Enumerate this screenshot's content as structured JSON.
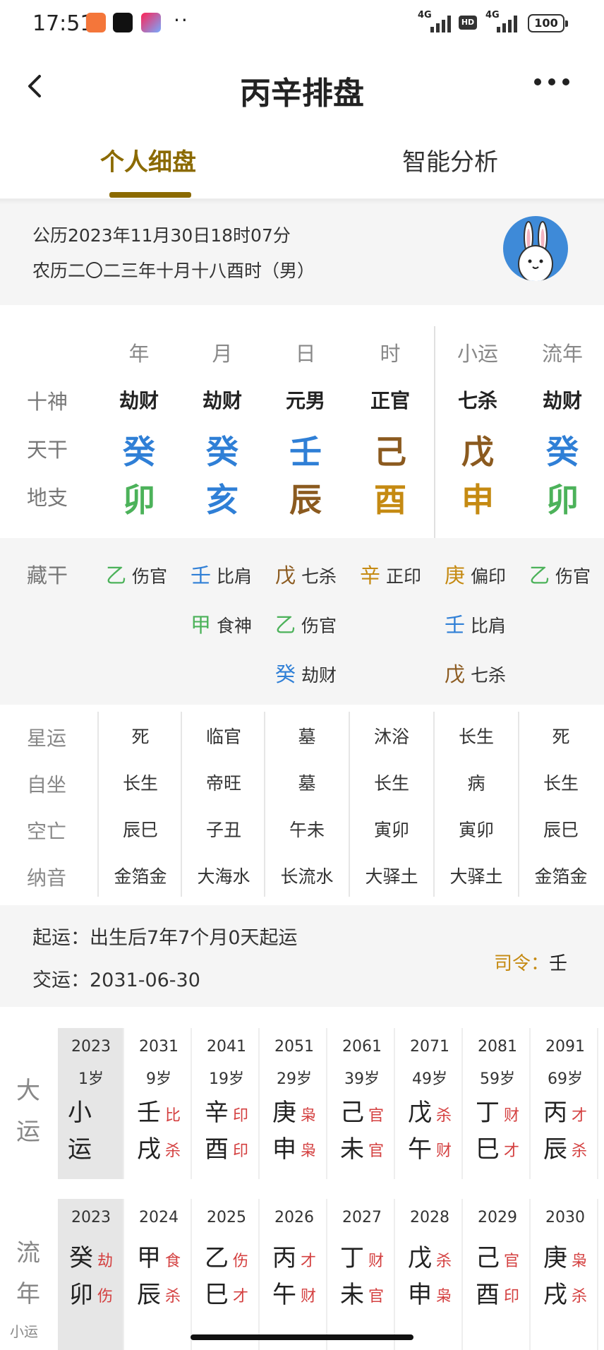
{
  "status_bar": {
    "time": "17:51",
    "net1": "4G",
    "net2": "4G",
    "hd": "HD",
    "battery": "100"
  },
  "nav": {
    "title": "丙辛排盘",
    "back_icon": "chevron-left-icon",
    "more_icon": "more-dots-icon"
  },
  "tabs": [
    {
      "label": "个人细盘",
      "active": true
    },
    {
      "label": "智能分析",
      "active": false
    }
  ],
  "info": {
    "solar": "公历2023年11月30日18时07分",
    "lunar": "农历二〇二三年十月十八酉时（男）",
    "avatar_icon": "rabbit-avatar-icon"
  },
  "pillars": {
    "headers": [
      "年",
      "月",
      "日",
      "时",
      "小运",
      "流年"
    ],
    "row_labels": [
      "十神",
      "天干",
      "地支"
    ],
    "shishen": [
      "劫财",
      "劫财",
      "元男",
      "正官",
      "七杀",
      "劫财"
    ],
    "tiangan": [
      "癸",
      "癸",
      "壬",
      "己",
      "戊",
      "癸"
    ],
    "dizhi": [
      "卯",
      "亥",
      "辰",
      "酉",
      "申",
      "卯"
    ],
    "colors": {
      "blue": "#2f7fd6",
      "green": "#4cb25a",
      "brown": "#8b5a1f",
      "gold": "#c58a12"
    }
  },
  "hidden_stems": {
    "label": "藏干",
    "columns": [
      [
        {
          "stem": "乙",
          "god": "伤官"
        }
      ],
      [
        {
          "stem": "壬",
          "god": "比肩"
        },
        {
          "stem": "甲",
          "god": "食神"
        }
      ],
      [
        {
          "stem": "戊",
          "god": "七杀"
        },
        {
          "stem": "乙",
          "god": "伤官"
        },
        {
          "stem": "癸",
          "god": "劫财"
        }
      ],
      [
        {
          "stem": "辛",
          "god": "正印"
        }
      ],
      [
        {
          "stem": "庚",
          "god": "偏印"
        },
        {
          "stem": "壬",
          "god": "比肩"
        },
        {
          "stem": "戊",
          "god": "七杀"
        }
      ],
      [
        {
          "stem": "乙",
          "god": "伤官"
        }
      ]
    ]
  },
  "details": {
    "labels": [
      "星运",
      "自坐",
      "空亡",
      "纳音"
    ],
    "rows": [
      [
        "死",
        "临官",
        "墓",
        "沐浴",
        "长生",
        "死"
      ],
      [
        "长生",
        "帝旺",
        "墓",
        "长生",
        "病",
        "长生"
      ],
      [
        "辰巳",
        "子丑",
        "午未",
        "寅卯",
        "寅卯",
        "辰巳"
      ],
      [
        "金箔金",
        "大海水",
        "长流水",
        "大驿土",
        "大驿土",
        "金箔金"
      ]
    ]
  },
  "qiyun": {
    "start": "起运：出生后7年7个月0天起运",
    "jiao": "交运：2031-06-30",
    "siling_label": "司令：",
    "siling_value": "壬"
  },
  "dayun": {
    "side_label": [
      "大",
      "运"
    ],
    "first": {
      "year": "2023",
      "age": "1岁",
      "text": [
        "小",
        "运"
      ]
    },
    "items": [
      {
        "year": "2031",
        "age": "9岁",
        "gan": "壬",
        "gan_s": "比",
        "zhi": "戌",
        "zhi_s": "杀"
      },
      {
        "year": "2041",
        "age": "19岁",
        "gan": "辛",
        "gan_s": "印",
        "zhi": "酉",
        "zhi_s": "印"
      },
      {
        "year": "2051",
        "age": "29岁",
        "gan": "庚",
        "gan_s": "枭",
        "zhi": "申",
        "zhi_s": "枭"
      },
      {
        "year": "2061",
        "age": "39岁",
        "gan": "己",
        "gan_s": "官",
        "zhi": "未",
        "zhi_s": "官"
      },
      {
        "year": "2071",
        "age": "49岁",
        "gan": "戊",
        "gan_s": "杀",
        "zhi": "午",
        "zhi_s": "财"
      },
      {
        "year": "2081",
        "age": "59岁",
        "gan": "丁",
        "gan_s": "财",
        "zhi": "巳",
        "zhi_s": "才"
      },
      {
        "year": "2091",
        "age": "69岁",
        "gan": "丙",
        "gan_s": "才",
        "zhi": "辰",
        "zhi_s": "杀"
      }
    ]
  },
  "liunian": {
    "side_label": [
      "流",
      "年"
    ],
    "side_sub": "小运",
    "items": [
      {
        "year": "2023",
        "gan": "癸",
        "gan_s": "劫",
        "zhi": "卯",
        "zhi_s": "伤"
      },
      {
        "year": "2024",
        "gan": "甲",
        "gan_s": "食",
        "zhi": "辰",
        "zhi_s": "杀"
      },
      {
        "year": "2025",
        "gan": "乙",
        "gan_s": "伤",
        "zhi": "巳",
        "zhi_s": "才"
      },
      {
        "year": "2026",
        "gan": "丙",
        "gan_s": "才",
        "zhi": "午",
        "zhi_s": "财"
      },
      {
        "year": "2027",
        "gan": "丁",
        "gan_s": "财",
        "zhi": "未",
        "zhi_s": "官"
      },
      {
        "year": "2028",
        "gan": "戊",
        "gan_s": "杀",
        "zhi": "申",
        "zhi_s": "枭"
      },
      {
        "year": "2029",
        "gan": "己",
        "gan_s": "官",
        "zhi": "酉",
        "zhi_s": "印"
      },
      {
        "year": "2030",
        "gan": "庚",
        "gan_s": "枭",
        "zhi": "戌",
        "zhi_s": "杀"
      }
    ]
  }
}
